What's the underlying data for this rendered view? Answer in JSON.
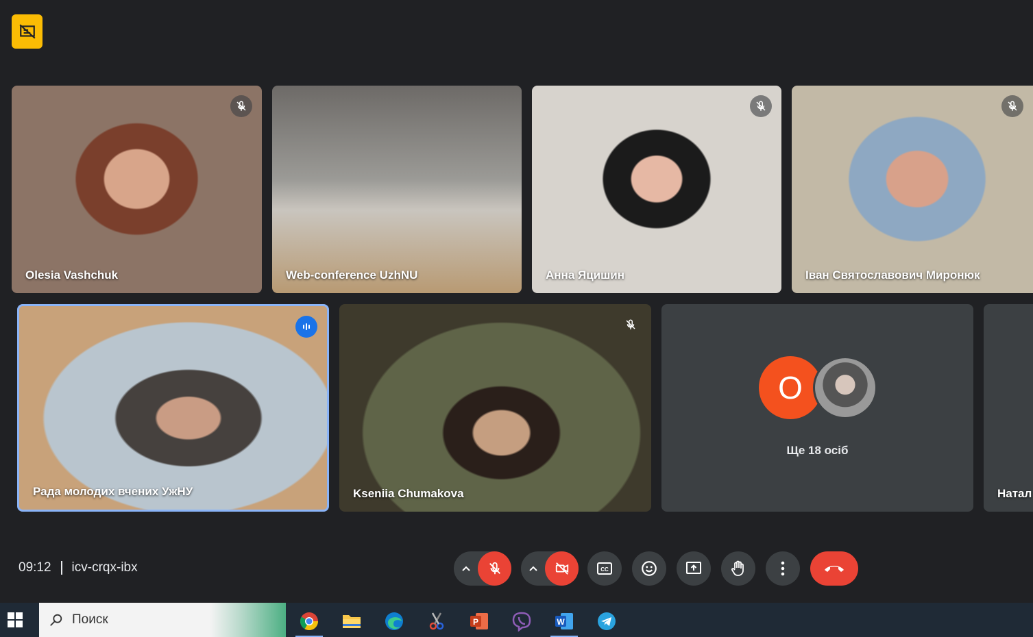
{
  "meeting": {
    "time": "09:12",
    "code": "icv-crqx-ibx"
  },
  "participants": [
    {
      "name": "Olesia Vashchuk",
      "muted": true
    },
    {
      "name": "Web-conference UzhNU",
      "muted": false
    },
    {
      "name": "Анна Яцишин",
      "muted": true
    },
    {
      "name": "Іван Святославович Миронюк",
      "muted": true
    },
    {
      "name": "Рада молодих вчених УжНУ",
      "speaking": true
    },
    {
      "name": "Kseniia Chumakova",
      "muted": true
    },
    {
      "name": "Натал",
      "muted": false
    }
  ],
  "overflow": {
    "avatar_letter": "O",
    "label": "Ще 18 осіб"
  },
  "controls": {
    "mic": "muted",
    "camera": "off",
    "icons": [
      "chevron-up-icon",
      "mic-off-icon",
      "camera-off-icon",
      "captions-icon",
      "emoji-icon",
      "present-icon",
      "raise-hand-icon",
      "more-vert-icon",
      "end-call-icon"
    ]
  },
  "taskbar": {
    "search_placeholder": "Поиск",
    "apps": [
      "chrome-icon",
      "file-explorer-icon",
      "edge-icon",
      "snipping-tool-icon",
      "powerpoint-icon",
      "viber-icon",
      "word-icon",
      "telegram-icon"
    ]
  },
  "colors": {
    "background": "#202124",
    "tile": "#3c4043",
    "danger": "#ea4335",
    "accent": "#fbbc04",
    "speaking_border": "#8ab4f8",
    "avatar": "#f4511e"
  }
}
